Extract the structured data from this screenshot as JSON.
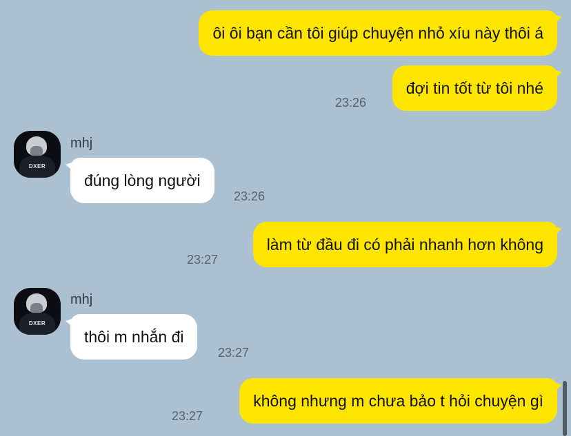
{
  "chat": {
    "messages": [
      {
        "id": "m1",
        "direction": "outgoing",
        "text": "ôi ôi bạn cần tôi giúp chuyện nhỏ xíu này thôi á",
        "time": ""
      },
      {
        "id": "m2",
        "direction": "outgoing",
        "text": "đợi tin tốt từ tôi nhé",
        "time": "23:26"
      },
      {
        "id": "m3",
        "direction": "incoming",
        "sender": "mhj",
        "avatar_text": "DXER",
        "text": "đúng lòng người",
        "time": "23:26"
      },
      {
        "id": "m4",
        "direction": "outgoing",
        "text": "làm từ đầu đi có phải nhanh hơn không",
        "time": "23:27"
      },
      {
        "id": "m5",
        "direction": "incoming",
        "sender": "mhj",
        "avatar_text": "DXER",
        "text": "thôi m nhắn đi",
        "time": "23:27"
      },
      {
        "id": "m6",
        "direction": "outgoing",
        "text": "không nhưng m chưa bảo t hỏi chuyện gì",
        "time": "23:27"
      }
    ]
  },
  "colors": {
    "background": "#abc1d1",
    "outgoing_bubble": "#fee500",
    "incoming_bubble": "#ffffff",
    "timestamp": "#55636f"
  }
}
